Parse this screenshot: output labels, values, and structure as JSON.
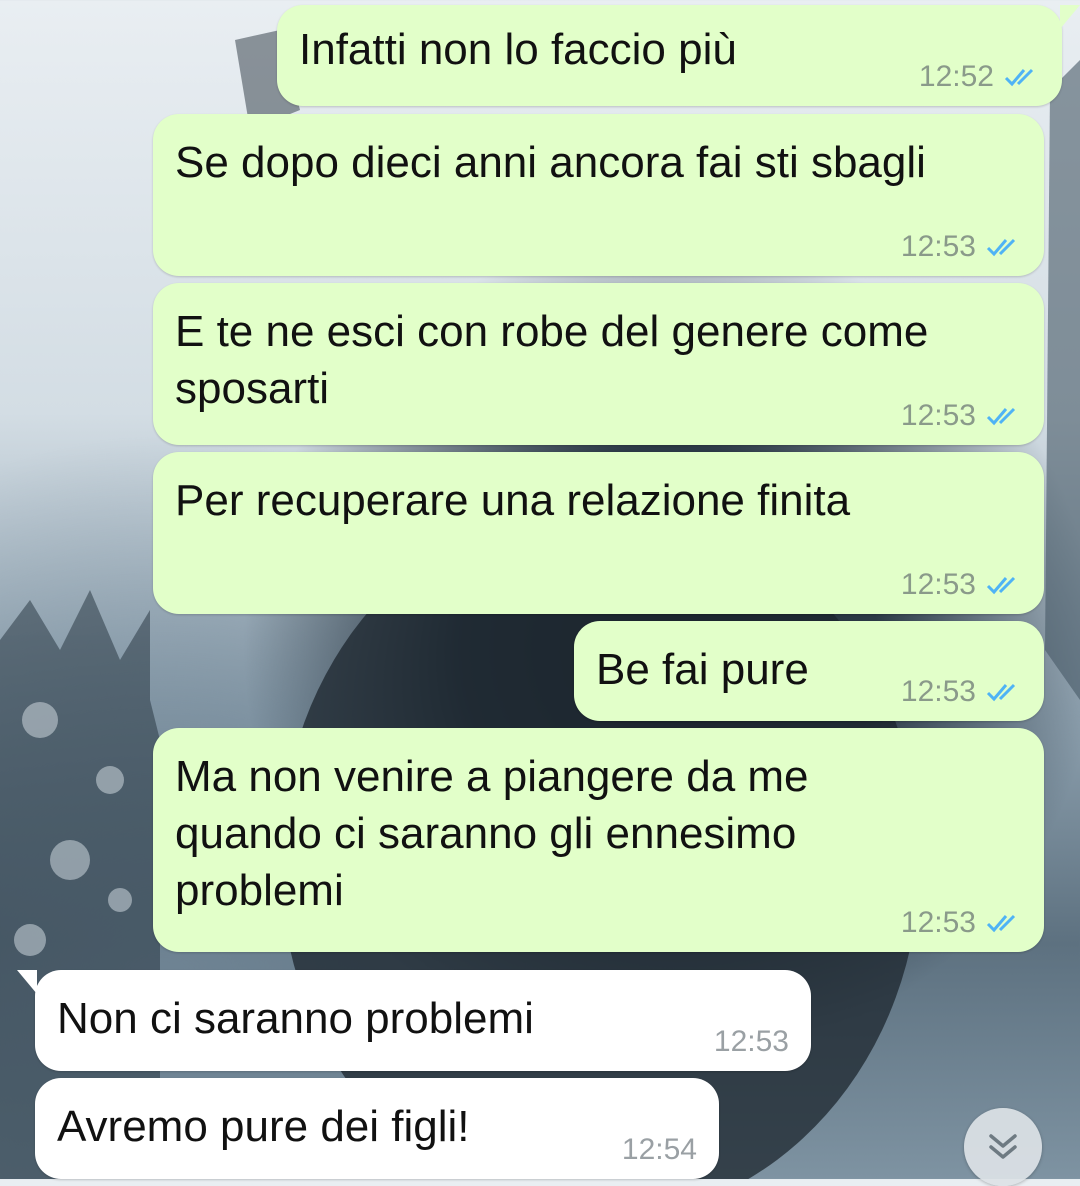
{
  "colors": {
    "outgoing_bubble": "#e2ffc9",
    "incoming_bubble": "#ffffff",
    "read_ticks": "#4fb3f5"
  },
  "messages": [
    {
      "direction": "outgoing",
      "text": "Infatti non lo faccio più",
      "time": "12:52",
      "status": "read"
    },
    {
      "direction": "outgoing",
      "text": "Se dopo dieci anni ancora fai sti sbagli",
      "time": "12:53",
      "status": "read"
    },
    {
      "direction": "outgoing",
      "text": "E te ne esci con robe del genere come sposarti",
      "time": "12:53",
      "status": "read"
    },
    {
      "direction": "outgoing",
      "text": "Per recuperare una relazione finita",
      "time": "12:53",
      "status": "read"
    },
    {
      "direction": "outgoing",
      "text": "Be fai pure",
      "time": "12:53",
      "status": "read"
    },
    {
      "direction": "outgoing",
      "text": "Ma non venire a piangere da me quando ci saranno gli ennesimo problemi",
      "time": "12:53",
      "status": "read"
    },
    {
      "direction": "incoming",
      "text": "Non ci saranno problemi",
      "time": "12:53"
    },
    {
      "direction": "incoming",
      "text": "Avremo pure dei figli!",
      "time": "12:54"
    }
  ],
  "scroll_button": {
    "icon": "double-chevron-down-icon"
  }
}
